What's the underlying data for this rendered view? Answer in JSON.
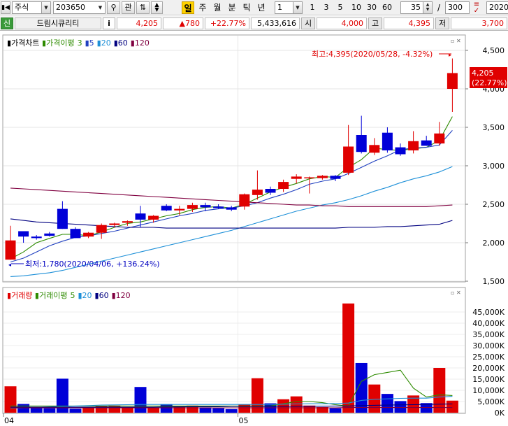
{
  "toolbar": {
    "market": "주식",
    "code": "203650",
    "gwan_label": "관",
    "day_chip": "일",
    "period_week": "주",
    "period_month": "월",
    "period_minute": "분",
    "period_tick": "틱",
    "period_year": "년",
    "interval_value": "1",
    "interval_presets": [
      "1",
      "3",
      "5",
      "10",
      "30",
      "60"
    ],
    "display_count": "35",
    "separator": "/",
    "total_count": "300",
    "date_partial": "2020"
  },
  "quote": {
    "badge": "신",
    "name": "드림시큐리티",
    "info_btn": "i",
    "price": "4,205",
    "change": "▲780",
    "change_pct": "+22.77%",
    "volume": "5,433,616",
    "open_label": "시",
    "open": "4,000",
    "high_label": "고",
    "high": "4,395",
    "low_label": "저",
    "low": "3,700"
  },
  "price_panel": {
    "legend_title": "가격차트",
    "legend_ma_label": "가격이평",
    "legend_ma_periods": [
      "3",
      "5",
      "20",
      "60",
      "120"
    ],
    "high_annotation": "최고:4,395(2020/05/28, -4.32%)",
    "low_annotation": "최저:1,780(2020/04/06, +136.24%)",
    "current_price_tag": "4,205",
    "current_pct_tag": "(22.77%)",
    "y_ticks": [
      "4,500",
      "4,000",
      "3,500",
      "3,000",
      "2,500",
      "2,000",
      "1,500"
    ]
  },
  "volume_panel": {
    "legend_title": "거래량",
    "legend_ma_label": "거래이평",
    "legend_ma_periods": [
      "5",
      "20",
      "60",
      "120"
    ],
    "y_ticks": [
      "45,000K",
      "40,000K",
      "35,000K",
      "30,000K",
      "25,000K",
      "20,000K",
      "15,000K",
      "10,000K",
      "5,000K",
      "0K"
    ]
  },
  "x_axis_labels": [
    "04",
    "05"
  ],
  "colors": {
    "up": "#e00000",
    "down": "#0000d8",
    "ma3": "#2e8b00",
    "ma5": "#2040c0",
    "ma20": "#1e90d8",
    "ma60": "#000080",
    "ma120": "#800040"
  },
  "chart_data": {
    "type": "candlestick",
    "price_unit": "KRW",
    "price_ylim": [
      1500,
      4500
    ],
    "candles": [
      {
        "o": 1780,
        "h": 2220,
        "l": 1780,
        "c": 2030
      },
      {
        "o": 2150,
        "h": 2150,
        "l": 2000,
        "c": 2080
      },
      {
        "o": 2080,
        "h": 2100,
        "l": 2040,
        "c": 2060
      },
      {
        "o": 2120,
        "h": 2140,
        "l": 2080,
        "c": 2090
      },
      {
        "o": 2440,
        "h": 2540,
        "l": 2180,
        "c": 2180
      },
      {
        "o": 2180,
        "h": 2200,
        "l": 2060,
        "c": 2060
      },
      {
        "o": 2080,
        "h": 2140,
        "l": 2060,
        "c": 2130
      },
      {
        "o": 2130,
        "h": 2250,
        "l": 2050,
        "c": 2230
      },
      {
        "o": 2230,
        "h": 2260,
        "l": 2200,
        "c": 2250
      },
      {
        "o": 2260,
        "h": 2290,
        "l": 2220,
        "c": 2280
      },
      {
        "o": 2380,
        "h": 2480,
        "l": 2200,
        "c": 2300
      },
      {
        "o": 2300,
        "h": 2360,
        "l": 2260,
        "c": 2350
      },
      {
        "o": 2480,
        "h": 2500,
        "l": 2410,
        "c": 2420
      },
      {
        "o": 2420,
        "h": 2480,
        "l": 2360,
        "c": 2440
      },
      {
        "o": 2440,
        "h": 2520,
        "l": 2400,
        "c": 2490
      },
      {
        "o": 2490,
        "h": 2520,
        "l": 2410,
        "c": 2460
      },
      {
        "o": 2470,
        "h": 2500,
        "l": 2440,
        "c": 2450
      },
      {
        "o": 2460,
        "h": 2480,
        "l": 2410,
        "c": 2430
      },
      {
        "o": 2470,
        "h": 2640,
        "l": 2430,
        "c": 2630
      },
      {
        "o": 2620,
        "h": 2940,
        "l": 2560,
        "c": 2690
      },
      {
        "o": 2700,
        "h": 2730,
        "l": 2620,
        "c": 2650
      },
      {
        "o": 2700,
        "h": 2820,
        "l": 2660,
        "c": 2790
      },
      {
        "o": 2830,
        "h": 2890,
        "l": 2770,
        "c": 2860
      },
      {
        "o": 2840,
        "h": 2860,
        "l": 2640,
        "c": 2850
      },
      {
        "o": 2840,
        "h": 2880,
        "l": 2820,
        "c": 2870
      },
      {
        "o": 2870,
        "h": 2880,
        "l": 2800,
        "c": 2830
      },
      {
        "o": 2910,
        "h": 3530,
        "l": 2880,
        "c": 3250
      },
      {
        "o": 3400,
        "h": 3650,
        "l": 3160,
        "c": 3180
      },
      {
        "o": 3170,
        "h": 3360,
        "l": 3140,
        "c": 3270
      },
      {
        "o": 3430,
        "h": 3500,
        "l": 3170,
        "c": 3200
      },
      {
        "o": 3240,
        "h": 3290,
        "l": 3130,
        "c": 3150
      },
      {
        "o": 3200,
        "h": 3450,
        "l": 3160,
        "c": 3320
      },
      {
        "o": 3330,
        "h": 3390,
        "l": 3260,
        "c": 3260
      },
      {
        "o": 3290,
        "h": 3570,
        "l": 3260,
        "c": 3420
      },
      {
        "o": 4000,
        "h": 4395,
        "l": 3700,
        "c": 4205
      }
    ],
    "volume_unit": "K shares",
    "volume_ylim": [
      0,
      50000
    ],
    "volumes": [
      11800,
      3900,
      2500,
      2000,
      15200,
      1800,
      2200,
      2900,
      3200,
      2600,
      11500,
      2400,
      3800,
      2800,
      3200,
      2400,
      2000,
      1600,
      3600,
      15400,
      4200,
      6000,
      7300,
      3200,
      2500,
      2000,
      48800,
      22200,
      12600,
      8400,
      5200,
      7700,
      4300,
      20000,
      5400
    ],
    "price_ma": [
      {
        "name": "3",
        "values": [
          1790,
          1880,
          2000,
          2056,
          2109,
          2110,
          2090,
          2140,
          2200,
          2250,
          2270,
          2310,
          2350,
          2380,
          2430,
          2460,
          2470,
          2450,
          2500,
          2580,
          2660,
          2720,
          2770,
          2830,
          2860,
          2850,
          2980,
          3080,
          3230,
          3210,
          3200,
          3220,
          3240,
          3330,
          3640
        ]
      },
      {
        "name": "5",
        "values": [
          1750,
          1800,
          1880,
          1960,
          2020,
          2070,
          2090,
          2120,
          2150,
          2190,
          2230,
          2270,
          2310,
          2350,
          2380,
          2420,
          2440,
          2450,
          2480,
          2520,
          2580,
          2630,
          2690,
          2760,
          2800,
          2830,
          2900,
          2980,
          3060,
          3130,
          3210,
          3230,
          3240,
          3270,
          3460
        ]
      },
      {
        "name": "20",
        "values": [
          1560,
          1570,
          1590,
          1610,
          1640,
          1680,
          1720,
          1760,
          1800,
          1840,
          1880,
          1920,
          1960,
          2000,
          2040,
          2080,
          2120,
          2160,
          2210,
          2260,
          2310,
          2360,
          2410,
          2450,
          2490,
          2520,
          2560,
          2610,
          2670,
          2720,
          2780,
          2830,
          2870,
          2920,
          2990
        ]
      },
      {
        "name": "60",
        "values": [
          2310,
          2290,
          2270,
          2260,
          2250,
          2240,
          2230,
          2220,
          2210,
          2200,
          2200,
          2200,
          2190,
          2190,
          2190,
          2190,
          2190,
          2190,
          2190,
          2190,
          2190,
          2190,
          2190,
          2190,
          2190,
          2190,
          2200,
          2200,
          2200,
          2210,
          2210,
          2220,
          2230,
          2240,
          2290
        ]
      },
      {
        "name": "120",
        "values": [
          2710,
          2700,
          2690,
          2680,
          2670,
          2660,
          2650,
          2640,
          2630,
          2620,
          2610,
          2600,
          2590,
          2580,
          2570,
          2560,
          2550,
          2540,
          2530,
          2520,
          2510,
          2500,
          2490,
          2490,
          2480,
          2480,
          2470,
          2470,
          2470,
          2470,
          2470,
          2470,
          2470,
          2480,
          2490
        ]
      }
    ],
    "volume_ma": [
      {
        "name": "5",
        "values": [
          3000,
          3000,
          3000,
          3000,
          3000,
          3000,
          3000,
          3000,
          3000,
          3000,
          3000,
          3000,
          3000,
          3000,
          3000,
          3000,
          3000,
          3000,
          3000,
          3000,
          3000,
          4000,
          5000,
          5000,
          4500,
          3600,
          3000,
          14000,
          17000,
          18000,
          19000,
          11000,
          7000,
          8000,
          7700
        ]
      },
      {
        "name": "20",
        "values": [
          2000,
          2200,
          2400,
          2600,
          2800,
          3000,
          3200,
          3400,
          3500,
          3600,
          3700,
          3700,
          3700,
          3700,
          3700,
          3700,
          3700,
          3700,
          3700,
          3700,
          3700,
          3800,
          3900,
          4000,
          4000,
          4100,
          4300,
          5500,
          6000,
          6200,
          6400,
          6500,
          6500,
          7000,
          7300
        ]
      },
      {
        "name": "60",
        "values": [
          2500,
          2500,
          2500,
          2500,
          2500,
          2500,
          2500,
          2500,
          2500,
          2500,
          2500,
          2500,
          2600,
          2600,
          2700,
          2700,
          2700,
          2800,
          2800,
          2800,
          2800,
          2800,
          2800,
          2900,
          2900,
          3000,
          3000,
          3200,
          3300,
          3400,
          3500,
          3600,
          3700,
          3800,
          3900
        ]
      },
      {
        "name": "120",
        "values": [
          2200,
          2200,
          2200,
          2200,
          2200,
          2200,
          2200,
          2200,
          2200,
          2200,
          2200,
          2200,
          2200,
          2200,
          2200,
          2200,
          2200,
          2200,
          2200,
          2200,
          2200,
          2200,
          2200,
          2200,
          2200,
          2200,
          2300,
          2300,
          2300,
          2300,
          2300,
          2300,
          2300,
          2300,
          2300
        ]
      }
    ]
  }
}
